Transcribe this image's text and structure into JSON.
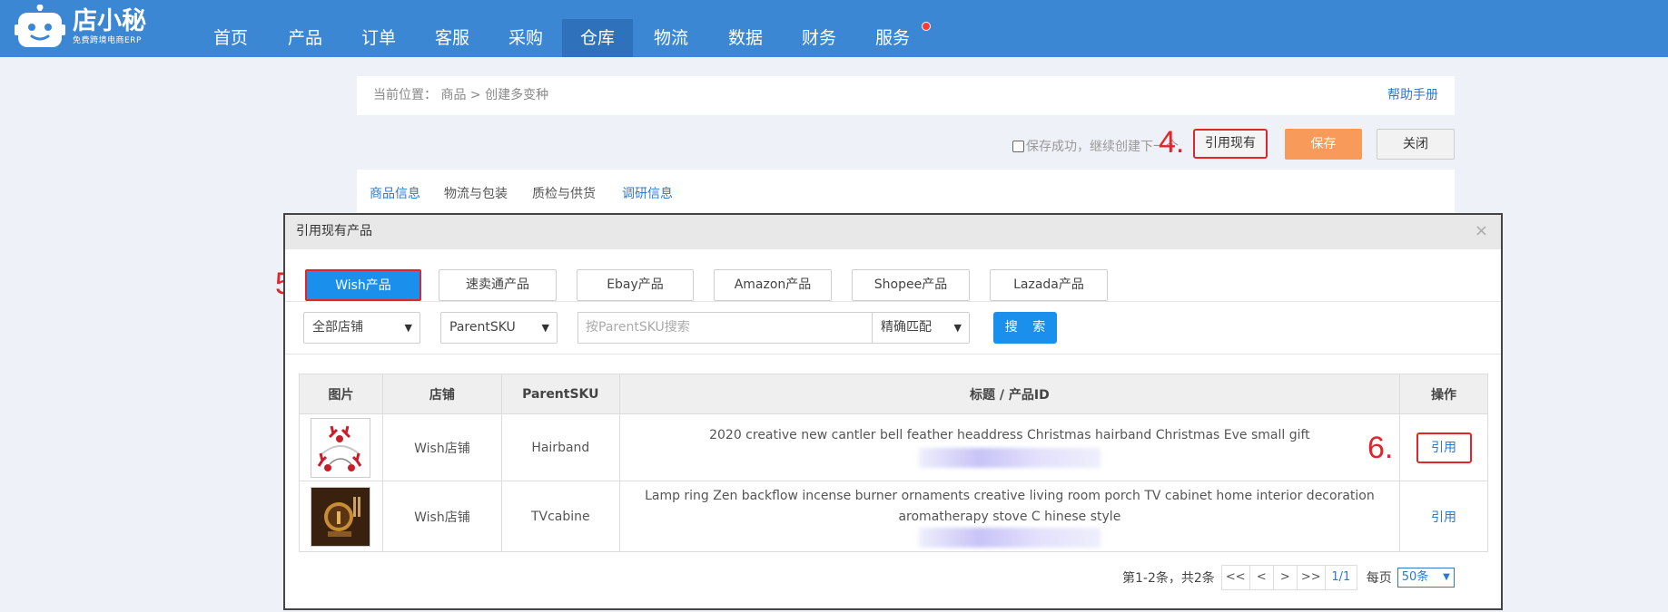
{
  "app": {
    "logo_main": "店小秘",
    "logo_sub": "免费跨境电商ERP"
  },
  "nav": [
    {
      "label": "首页"
    },
    {
      "label": "产品"
    },
    {
      "label": "订单"
    },
    {
      "label": "客服"
    },
    {
      "label": "采购"
    },
    {
      "label": "仓库",
      "active": true
    },
    {
      "label": "物流"
    },
    {
      "label": "数据"
    },
    {
      "label": "财务"
    },
    {
      "label": "服务",
      "dot": true
    }
  ],
  "breadcrumb": {
    "prefix": "当前位置：",
    "path": "商品 > 创建多变种",
    "help": "帮助手册"
  },
  "actions": {
    "checkbox_label": "保存成功，继续创建下一个",
    "cite_label": "引用现有",
    "save_label": "保存",
    "close_label": "关闭"
  },
  "page_tabs": [
    "商品信息",
    "物流与包装",
    "质检与供货",
    "调研信息"
  ],
  "annotations": {
    "step4": "4.",
    "step5": "5.",
    "step6": "6."
  },
  "modal": {
    "title": "引用现有产品",
    "close_symbol": "×",
    "platform_tabs": [
      "Wish产品",
      "速卖通产品",
      "Ebay产品",
      "Amazon产品",
      "Shopee产品",
      "Lazada产品"
    ],
    "filters": {
      "shop": "全部店铺",
      "field": "ParentSKU",
      "search_placeholder": "按ParentSKU搜索",
      "match": "精确匹配",
      "search_button": "搜 索"
    },
    "table": {
      "headers": [
        "图片",
        "店铺",
        "ParentSKU",
        "标题 / 产品ID",
        "操作"
      ],
      "rows": [
        {
          "shop": "Wish店铺",
          "sku": "Hairband",
          "title": "2020 creative new cantler bell feather headdress Christmas hairband Christmas Eve small gift",
          "action": "引用"
        },
        {
          "shop": "Wish店铺",
          "sku": "TVcabine",
          "title": "Lamp ring Zen backflow incense burner ornaments creative living room porch TV cabinet home interior decoration aromatherapy stove C hinese style",
          "action": "引用"
        }
      ]
    },
    "pager": {
      "summary": "第1-2条，共2条",
      "first": "<<",
      "prev": "<",
      "next": ">",
      "last": ">>",
      "current": "1/1",
      "per_page_label": "每页",
      "per_page": "50条"
    }
  },
  "colors": {
    "topbar": "#3b87d3",
    "accent_blue": "#1a8fec",
    "save_orange": "#f79a5a",
    "annotation_red": "#e1262b"
  }
}
